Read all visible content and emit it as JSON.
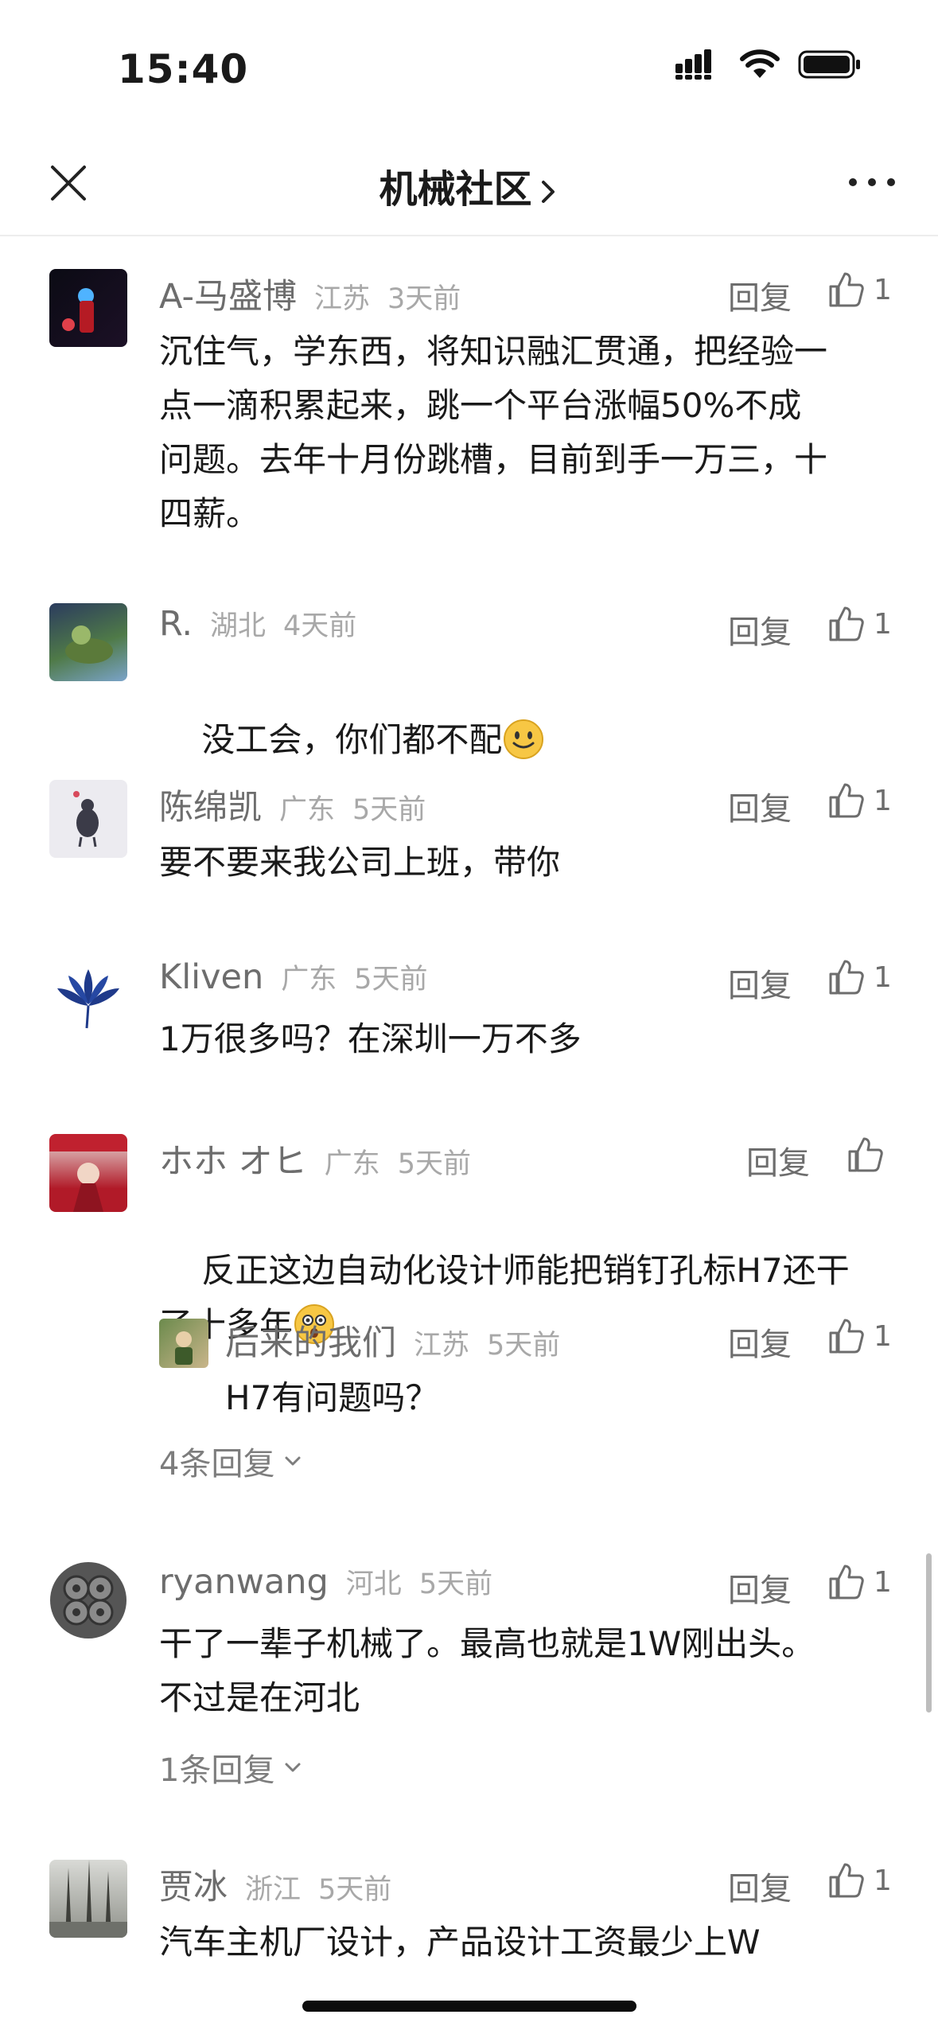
{
  "status": {
    "time": "15:40"
  },
  "nav": {
    "title": "机械社区"
  },
  "reply_label": "回复",
  "comments": [
    {
      "user": "A-马盛博",
      "location": "江苏",
      "ago": "3天前",
      "likes": "1",
      "text": "沉住气，学东西，将知识融汇贯通，把经验一\n点一滴积累起来，跳一个平台涨幅50%不成\n问题。去年十月份跳槽，目前到手一万三，十\n四薪。"
    },
    {
      "user": "R.",
      "location": "湖北",
      "ago": "4天前",
      "likes": "1",
      "text": "没工会，你们都不配"
    },
    {
      "user": "陈绵凯",
      "location": "广东",
      "ago": "5天前",
      "likes": "1",
      "text": "要不要来我公司上班，带你"
    },
    {
      "user": "Kliven",
      "location": "广东",
      "ago": "5天前",
      "likes": "1",
      "text": "1万很多吗？在深圳一万不多"
    },
    {
      "user": "ホホ オヒ",
      "location": "广东",
      "ago": "5天前",
      "likes": "",
      "text": "反正这边自动化设计师能把销钉孔标H7还干\n了十多年",
      "reply": {
        "user": "后来的我们",
        "location": "江苏",
        "ago": "5天前",
        "likes": "1",
        "text": "H7有问题吗？"
      },
      "more_replies": "4条回复"
    },
    {
      "user": "ryanwang",
      "location": "河北",
      "ago": "5天前",
      "likes": "1",
      "text": "干了一辈子机械了。最高也就是1W刚出头。\n不过是在河北",
      "more_replies": "1条回复"
    },
    {
      "user": "贾冰",
      "location": "浙江",
      "ago": "5天前",
      "likes": "1",
      "text": "汽车主机厂设计，产品设计工资最少上W"
    }
  ]
}
